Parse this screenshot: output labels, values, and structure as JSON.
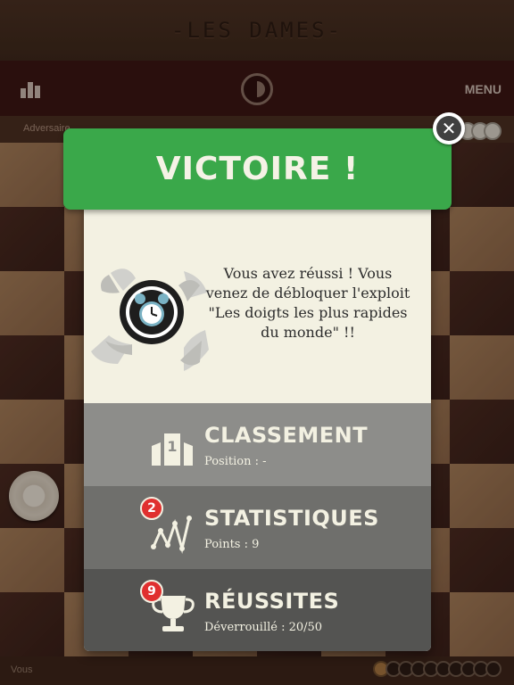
{
  "app": {
    "title": "-LES DAMES-"
  },
  "toolbar": {
    "menu_label": "MENU"
  },
  "players": {
    "opponent_label": "Adversaire",
    "self_label": "Vous"
  },
  "modal": {
    "title": "VICTOIRE !",
    "close_symbol": "✕",
    "message": "Vous avez réussi ! Vous venez de débloquer l'exploit \"Les doigts les plus rapides du monde\" !!",
    "achievement_icon": "alarm-clock-icon",
    "rows": [
      {
        "title": "CLASSEMENT",
        "subtitle": "Position : -",
        "icon": "podium-icon",
        "badge": null
      },
      {
        "title": "STATISTIQUES",
        "subtitle": "Points : 9",
        "icon": "stats-graph-icon",
        "badge": "2"
      },
      {
        "title": "RÉUSSITES",
        "subtitle": "Déverrouillé : 20/50",
        "icon": "trophy-icon",
        "badge": "9"
      }
    ]
  },
  "colors": {
    "victory_green": "#3aa84a",
    "modal_bg": "#f3f1e2",
    "badge_red": "#e0302f",
    "row_1": "#8d8d8a",
    "row_2": "#6f6f6c",
    "row_3": "#545452"
  }
}
